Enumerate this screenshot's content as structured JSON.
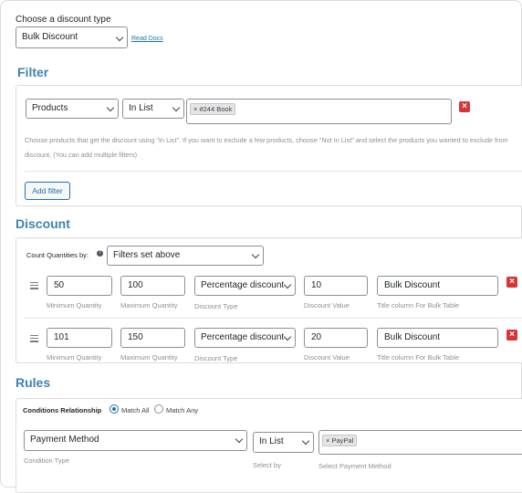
{
  "header": {
    "discount_type_label": "Choose a discount type",
    "discount_type_value": "Bulk Discount",
    "read_docs": "Read Docs"
  },
  "filter": {
    "title": "Filter",
    "type_value": "Products",
    "operator_value": "In List",
    "tags": [
      "#244 Book"
    ],
    "help_text_line1": "Choose products that get the discount using \"In List\". If you want to exclude a few products, choose \"Not In List\" and select the products you wanted to exclude from",
    "help_text_line2": "discount. (You can add multiple filters)",
    "add_filter_label": "Add filter"
  },
  "discount": {
    "title": "Discount",
    "count_label": "Count Quantities by:",
    "count_value": "Filters set above",
    "field_labels": {
      "min": "Minimum Quantity",
      "max": "Maximum Quantity",
      "type": "Discount Type",
      "value": "Discount Value",
      "title": "Title column For Bulk Table"
    },
    "ranges": [
      {
        "min": "50",
        "max": "100",
        "type": "Percentage discount",
        "value": "10",
        "title": "Bulk Discount"
      },
      {
        "min": "101",
        "max": "150",
        "type": "Percentage discount",
        "value": "20",
        "title": "Bulk Discount"
      }
    ]
  },
  "rules": {
    "title": "Rules",
    "relationship_label": "Conditions Relationship",
    "match_all": "Match All",
    "match_any": "Match Any",
    "condition_type_value": "Payment Method",
    "condition_type_label": "Condition Type",
    "select_by_value": "In List",
    "select_by_label": "Select by",
    "payment_tags": [
      "PayPal"
    ],
    "payment_label": "Select Payment Method"
  },
  "colors": {
    "accent": "#3e82b4",
    "link": "#2271b1",
    "delete": "#d63638"
  }
}
